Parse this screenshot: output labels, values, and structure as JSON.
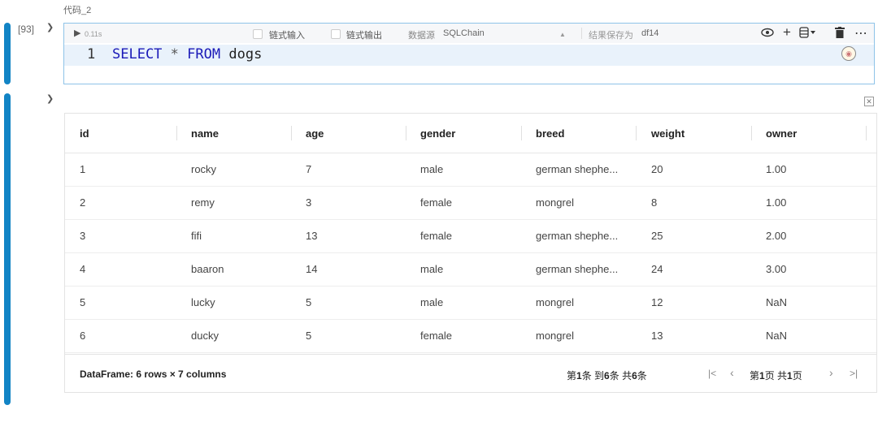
{
  "cell": {
    "title": "代码_2",
    "exec_count": "[93]",
    "elapsed": "0.11s",
    "chain_input": "链式输入",
    "chain_output": "链式输出",
    "datasource_label": "数据源",
    "datasource_value": "SQLChain",
    "save_as_label": "结果保存为",
    "save_as_value": "df14"
  },
  "code": {
    "line_number": "1",
    "kw_select": "SELECT",
    "star": "*",
    "kw_from": "FROM",
    "table": "dogs"
  },
  "table": {
    "columns": [
      "id",
      "name",
      "age",
      "gender",
      "breed",
      "weight",
      "owner"
    ],
    "rows": [
      [
        "1",
        "rocky",
        "7",
        "male",
        "german shephe...",
        "20",
        "1.00"
      ],
      [
        "2",
        "remy",
        "3",
        "female",
        "mongrel",
        "8",
        "1.00"
      ],
      [
        "3",
        "fifi",
        "13",
        "female",
        "german shephe...",
        "25",
        "2.00"
      ],
      [
        "4",
        "baaron",
        "14",
        "male",
        "german shephe...",
        "24",
        "3.00"
      ],
      [
        "5",
        "lucky",
        "5",
        "male",
        "mongrel",
        "12",
        "NaN"
      ],
      [
        "6",
        "ducky",
        "5",
        "female",
        "mongrel",
        "13",
        "NaN"
      ]
    ]
  },
  "footer": {
    "summary": "DataFrame: 6 rows × 7 columns",
    "range_p1": "第",
    "range_a": "1",
    "range_p2": "条 到",
    "range_b": "6",
    "range_p3": "条 共",
    "range_c": "6",
    "range_p4": "条",
    "page_p1": "第",
    "page_a": "1",
    "page_p2": "页 共",
    "page_b": "1",
    "page_p3": "页"
  },
  "icons": [
    "run-icon",
    "eye-icon",
    "plus-icon",
    "database-icon",
    "trash-icon",
    "more-icon",
    "ai-assistant-icon",
    "collapse-icon",
    "close-icon",
    "first-page-icon",
    "prev-page-icon",
    "next-page-icon",
    "last-page-icon"
  ],
  "colors": {
    "accent": "#1284c5",
    "keyword": "#1a1ab8",
    "editor_bg": "#e9f2fb"
  }
}
